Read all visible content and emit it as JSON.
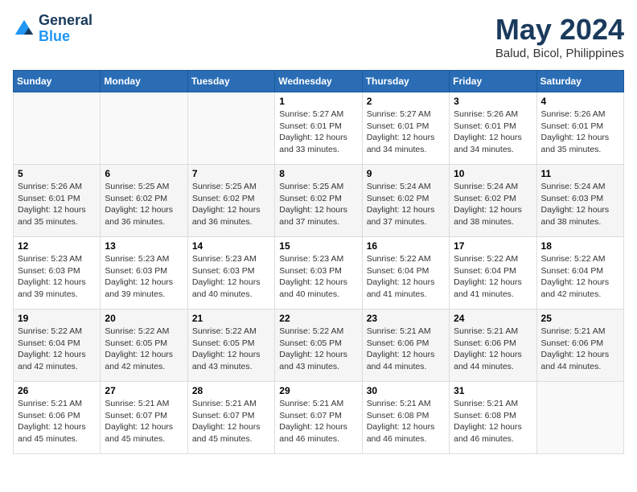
{
  "header": {
    "logo_line1": "General",
    "logo_line2": "Blue",
    "title": "May 2024",
    "subtitle": "Balud, Bicol, Philippines"
  },
  "columns": [
    "Sunday",
    "Monday",
    "Tuesday",
    "Wednesday",
    "Thursday",
    "Friday",
    "Saturday"
  ],
  "weeks": [
    [
      {
        "day": "",
        "sunrise": "",
        "sunset": "",
        "daylight": ""
      },
      {
        "day": "",
        "sunrise": "",
        "sunset": "",
        "daylight": ""
      },
      {
        "day": "",
        "sunrise": "",
        "sunset": "",
        "daylight": ""
      },
      {
        "day": "1",
        "sunrise": "Sunrise: 5:27 AM",
        "sunset": "Sunset: 6:01 PM",
        "daylight": "Daylight: 12 hours and 33 minutes."
      },
      {
        "day": "2",
        "sunrise": "Sunrise: 5:27 AM",
        "sunset": "Sunset: 6:01 PM",
        "daylight": "Daylight: 12 hours and 34 minutes."
      },
      {
        "day": "3",
        "sunrise": "Sunrise: 5:26 AM",
        "sunset": "Sunset: 6:01 PM",
        "daylight": "Daylight: 12 hours and 34 minutes."
      },
      {
        "day": "4",
        "sunrise": "Sunrise: 5:26 AM",
        "sunset": "Sunset: 6:01 PM",
        "daylight": "Daylight: 12 hours and 35 minutes."
      }
    ],
    [
      {
        "day": "5",
        "sunrise": "Sunrise: 5:26 AM",
        "sunset": "Sunset: 6:01 PM",
        "daylight": "Daylight: 12 hours and 35 minutes."
      },
      {
        "day": "6",
        "sunrise": "Sunrise: 5:25 AM",
        "sunset": "Sunset: 6:02 PM",
        "daylight": "Daylight: 12 hours and 36 minutes."
      },
      {
        "day": "7",
        "sunrise": "Sunrise: 5:25 AM",
        "sunset": "Sunset: 6:02 PM",
        "daylight": "Daylight: 12 hours and 36 minutes."
      },
      {
        "day": "8",
        "sunrise": "Sunrise: 5:25 AM",
        "sunset": "Sunset: 6:02 PM",
        "daylight": "Daylight: 12 hours and 37 minutes."
      },
      {
        "day": "9",
        "sunrise": "Sunrise: 5:24 AM",
        "sunset": "Sunset: 6:02 PM",
        "daylight": "Daylight: 12 hours and 37 minutes."
      },
      {
        "day": "10",
        "sunrise": "Sunrise: 5:24 AM",
        "sunset": "Sunset: 6:02 PM",
        "daylight": "Daylight: 12 hours and 38 minutes."
      },
      {
        "day": "11",
        "sunrise": "Sunrise: 5:24 AM",
        "sunset": "Sunset: 6:03 PM",
        "daylight": "Daylight: 12 hours and 38 minutes."
      }
    ],
    [
      {
        "day": "12",
        "sunrise": "Sunrise: 5:23 AM",
        "sunset": "Sunset: 6:03 PM",
        "daylight": "Daylight: 12 hours and 39 minutes."
      },
      {
        "day": "13",
        "sunrise": "Sunrise: 5:23 AM",
        "sunset": "Sunset: 6:03 PM",
        "daylight": "Daylight: 12 hours and 39 minutes."
      },
      {
        "day": "14",
        "sunrise": "Sunrise: 5:23 AM",
        "sunset": "Sunset: 6:03 PM",
        "daylight": "Daylight: 12 hours and 40 minutes."
      },
      {
        "day": "15",
        "sunrise": "Sunrise: 5:23 AM",
        "sunset": "Sunset: 6:03 PM",
        "daylight": "Daylight: 12 hours and 40 minutes."
      },
      {
        "day": "16",
        "sunrise": "Sunrise: 5:22 AM",
        "sunset": "Sunset: 6:04 PM",
        "daylight": "Daylight: 12 hours and 41 minutes."
      },
      {
        "day": "17",
        "sunrise": "Sunrise: 5:22 AM",
        "sunset": "Sunset: 6:04 PM",
        "daylight": "Daylight: 12 hours and 41 minutes."
      },
      {
        "day": "18",
        "sunrise": "Sunrise: 5:22 AM",
        "sunset": "Sunset: 6:04 PM",
        "daylight": "Daylight: 12 hours and 42 minutes."
      }
    ],
    [
      {
        "day": "19",
        "sunrise": "Sunrise: 5:22 AM",
        "sunset": "Sunset: 6:04 PM",
        "daylight": "Daylight: 12 hours and 42 minutes."
      },
      {
        "day": "20",
        "sunrise": "Sunrise: 5:22 AM",
        "sunset": "Sunset: 6:05 PM",
        "daylight": "Daylight: 12 hours and 42 minutes."
      },
      {
        "day": "21",
        "sunrise": "Sunrise: 5:22 AM",
        "sunset": "Sunset: 6:05 PM",
        "daylight": "Daylight: 12 hours and 43 minutes."
      },
      {
        "day": "22",
        "sunrise": "Sunrise: 5:22 AM",
        "sunset": "Sunset: 6:05 PM",
        "daylight": "Daylight: 12 hours and 43 minutes."
      },
      {
        "day": "23",
        "sunrise": "Sunrise: 5:21 AM",
        "sunset": "Sunset: 6:06 PM",
        "daylight": "Daylight: 12 hours and 44 minutes."
      },
      {
        "day": "24",
        "sunrise": "Sunrise: 5:21 AM",
        "sunset": "Sunset: 6:06 PM",
        "daylight": "Daylight: 12 hours and 44 minutes."
      },
      {
        "day": "25",
        "sunrise": "Sunrise: 5:21 AM",
        "sunset": "Sunset: 6:06 PM",
        "daylight": "Daylight: 12 hours and 44 minutes."
      }
    ],
    [
      {
        "day": "26",
        "sunrise": "Sunrise: 5:21 AM",
        "sunset": "Sunset: 6:06 PM",
        "daylight": "Daylight: 12 hours and 45 minutes."
      },
      {
        "day": "27",
        "sunrise": "Sunrise: 5:21 AM",
        "sunset": "Sunset: 6:07 PM",
        "daylight": "Daylight: 12 hours and 45 minutes."
      },
      {
        "day": "28",
        "sunrise": "Sunrise: 5:21 AM",
        "sunset": "Sunset: 6:07 PM",
        "daylight": "Daylight: 12 hours and 45 minutes."
      },
      {
        "day": "29",
        "sunrise": "Sunrise: 5:21 AM",
        "sunset": "Sunset: 6:07 PM",
        "daylight": "Daylight: 12 hours and 46 minutes."
      },
      {
        "day": "30",
        "sunrise": "Sunrise: 5:21 AM",
        "sunset": "Sunset: 6:08 PM",
        "daylight": "Daylight: 12 hours and 46 minutes."
      },
      {
        "day": "31",
        "sunrise": "Sunrise: 5:21 AM",
        "sunset": "Sunset: 6:08 PM",
        "daylight": "Daylight: 12 hours and 46 minutes."
      },
      {
        "day": "",
        "sunrise": "",
        "sunset": "",
        "daylight": ""
      }
    ]
  ]
}
